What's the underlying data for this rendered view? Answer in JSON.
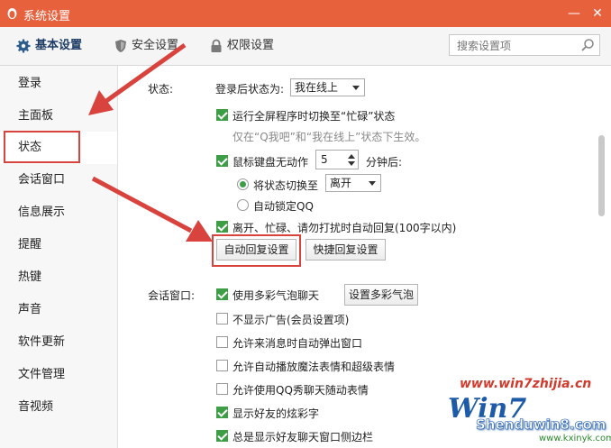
{
  "window": {
    "title": "系统设置",
    "minimize_label": "—",
    "close_label": "✕"
  },
  "tabs": [
    {
      "label": "基本设置",
      "icon": "gear-icon"
    },
    {
      "label": "安全设置",
      "icon": "shield-icon"
    },
    {
      "label": "权限设置",
      "icon": "lock-icon"
    }
  ],
  "search": {
    "placeholder": "搜索设置项"
  },
  "sidebar": {
    "items": [
      "登录",
      "主面板",
      "状态",
      "会话窗口",
      "信息展示",
      "提醒",
      "热键",
      "声音",
      "软件更新",
      "文件管理",
      "音视频"
    ],
    "active": "状态"
  },
  "status_section": {
    "label": "状态:",
    "login_status_label": "登录后状态为:",
    "login_status_value": "我在线上",
    "fullscreen_busy": "运行全屏程序时切换至“忙碌”状态",
    "fullscreen_note": "仅在“Q我吧”和“我在线上”状态下生效。",
    "idle_label": "鼠标键盘无动作",
    "idle_minutes": "5",
    "idle_suffix": "分钟后:",
    "switch_to_label": "将状态切换至",
    "switch_to_value": "离开",
    "auto_lock": "自动锁定QQ",
    "auto_reply": "离开、忙碌、请勿打扰时自动回复(100字以内)",
    "auto_reply_button": "自动回复设置",
    "quick_reply_button": "快捷回复设置"
  },
  "chat_section": {
    "label": "会话窗口:",
    "items": [
      {
        "label": "使用多彩气泡聊天",
        "checked": true
      },
      {
        "label": "不显示广告(会员设置项)",
        "checked": false
      },
      {
        "label": "允许来消息时自动弹出窗口",
        "checked": false
      },
      {
        "label": "允许自动播放魔法表情和超级表情",
        "checked": false
      },
      {
        "label": "允许使用QQ秀聊天随动表情",
        "checked": false
      },
      {
        "label": "显示好友的炫彩字",
        "checked": true
      },
      {
        "label": "总是显示好友聊天窗口侧边栏",
        "checked": true
      }
    ],
    "bubble_button": "设置多彩气泡"
  },
  "watermark": {
    "url": "www.win7zhijia.cn",
    "logo_text": "Win7",
    "brand": "Shenduwin8.com",
    "sub": "www.kxinyk.com"
  },
  "colors": {
    "titlebar": "#e8613d",
    "highlight": "#d8433d",
    "check": "#3d9e45"
  }
}
